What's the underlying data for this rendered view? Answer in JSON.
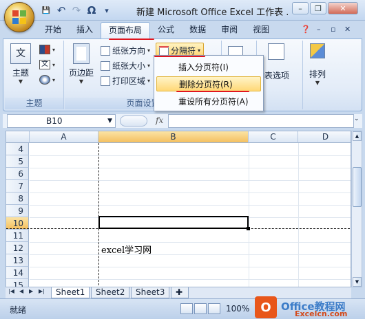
{
  "window": {
    "title": "新建 Microsoft Office Excel 工作表 ...",
    "minimize": "–",
    "restore": "❐",
    "close": "✕"
  },
  "qat": {
    "save": "💾",
    "undo": "↶",
    "redo": "↷",
    "omega": "Ω",
    "more": "▾"
  },
  "tabs": [
    {
      "label": "开始"
    },
    {
      "label": "插入"
    },
    {
      "label": "页面布局",
      "active": true
    },
    {
      "label": "公式"
    },
    {
      "label": "数据"
    },
    {
      "label": "审阅"
    },
    {
      "label": "视图"
    }
  ],
  "ribbon": {
    "theme_group": {
      "label": "主题",
      "button": "主题"
    },
    "page_setup_group": {
      "label": "页面设置",
      "margins": "页边距",
      "orientation": "纸张方向",
      "size": "纸张大小",
      "print_area": "打印区域",
      "breaks": "分隔符"
    },
    "arrange": {
      "selection_pane": "作表选项",
      "arrange": "排列"
    }
  },
  "breaks_menu": {
    "items": [
      {
        "label": "插入分页符(I)"
      },
      {
        "label": "删除分页符(R)",
        "highlighted": true
      },
      {
        "label": "重设所有分页符(A)"
      }
    ]
  },
  "formula_bar": {
    "name_box": "B10",
    "fx": "fx",
    "value": ""
  },
  "grid": {
    "columns": [
      "A",
      "B",
      "C",
      "D"
    ],
    "selected_column": "B",
    "rows": [
      "4",
      "5",
      "6",
      "7",
      "8",
      "9",
      "10",
      "11",
      "12",
      "13",
      "14",
      "15"
    ],
    "selected_row": "10",
    "cell_B12": "excel学习网"
  },
  "sheets": [
    "Sheet1",
    "Sheet2",
    "Sheet3"
  ],
  "status": {
    "ready": "就绪",
    "zoom": "100%"
  },
  "watermark": {
    "brand": "Office教程网",
    "site": "Excelcn.com"
  }
}
